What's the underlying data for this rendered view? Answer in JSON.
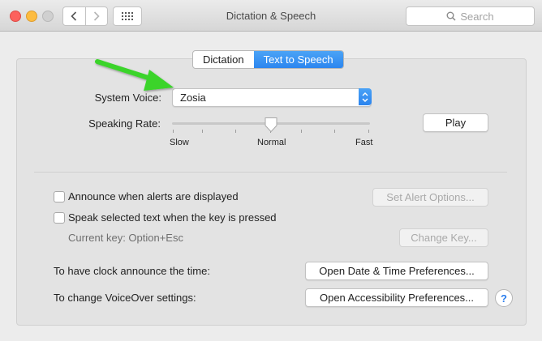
{
  "window": {
    "title": "Dictation & Speech"
  },
  "toolbar": {
    "search_placeholder": "Search"
  },
  "tabs": [
    {
      "label": "Dictation",
      "active": false
    },
    {
      "label": "Text to Speech",
      "active": true
    }
  ],
  "voice": {
    "label": "System Voice:",
    "value": "Zosia"
  },
  "rate": {
    "label": "Speaking Rate:",
    "slow": "Slow",
    "normal": "Normal",
    "fast": "Fast",
    "level": 0.5,
    "play_label": "Play"
  },
  "alerts": {
    "announce_label": "Announce when alerts are displayed",
    "announce_checked": false,
    "alert_options_label": "Set Alert Options...",
    "speak_label": "Speak selected text when the key is pressed",
    "speak_checked": false,
    "current_key": "Current key: Option+Esc",
    "change_key_label": "Change Key..."
  },
  "clock": {
    "label": "To have clock announce the time:",
    "button": "Open Date & Time Preferences..."
  },
  "voiceover": {
    "label": "To change VoiceOver settings:",
    "button": "Open Accessibility Preferences..."
  },
  "help": {
    "label": "?"
  },
  "colors": {
    "accent": "#2c86ef",
    "annotation_arrow": "#3ad42a",
    "close": "#fc615d",
    "minimize": "#fdbc40"
  }
}
